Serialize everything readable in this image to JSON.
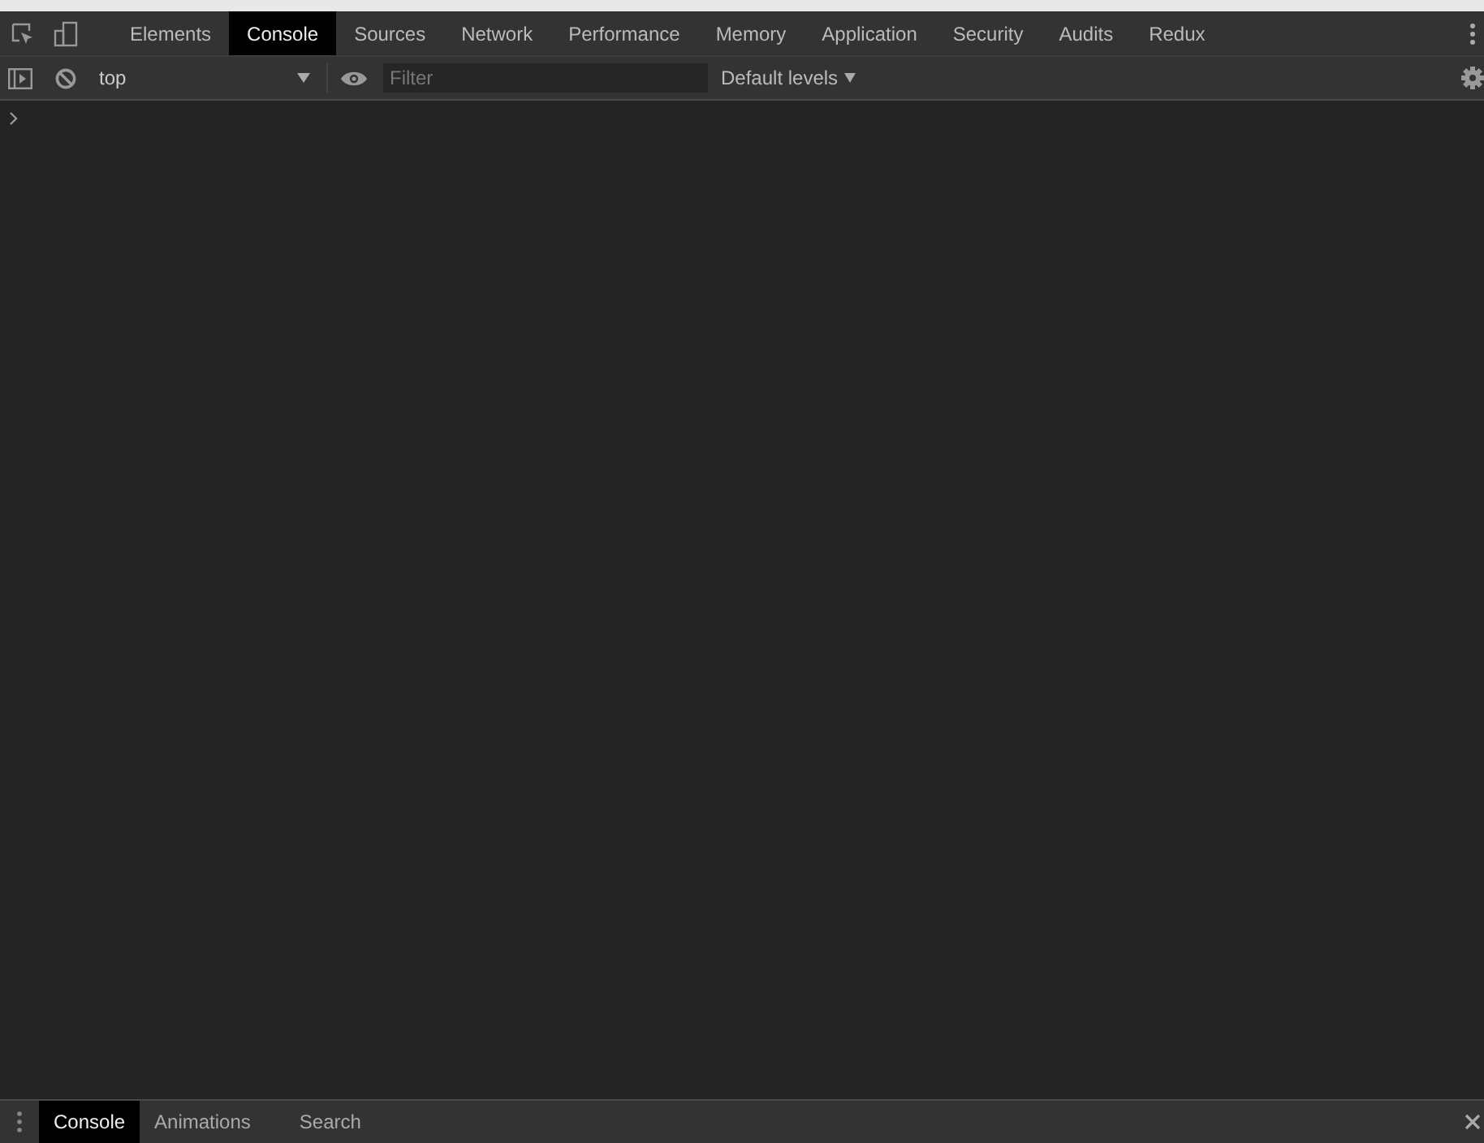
{
  "tabs": [
    {
      "label": "Elements",
      "selected": false
    },
    {
      "label": "Console",
      "selected": true
    },
    {
      "label": "Sources",
      "selected": false
    },
    {
      "label": "Network",
      "selected": false
    },
    {
      "label": "Performance",
      "selected": false
    },
    {
      "label": "Memory",
      "selected": false
    },
    {
      "label": "Application",
      "selected": false
    },
    {
      "label": "Security",
      "selected": false
    },
    {
      "label": "Audits",
      "selected": false
    },
    {
      "label": "Redux",
      "selected": false
    }
  ],
  "toolbar": {
    "context": "top",
    "filter": {
      "placeholder": "Filter"
    },
    "levels": "Default levels"
  },
  "drawer_tabs": [
    {
      "label": "Console",
      "selected": true
    },
    {
      "label": "Animations",
      "selected": false
    },
    {
      "label": "Search",
      "selected": false
    }
  ]
}
